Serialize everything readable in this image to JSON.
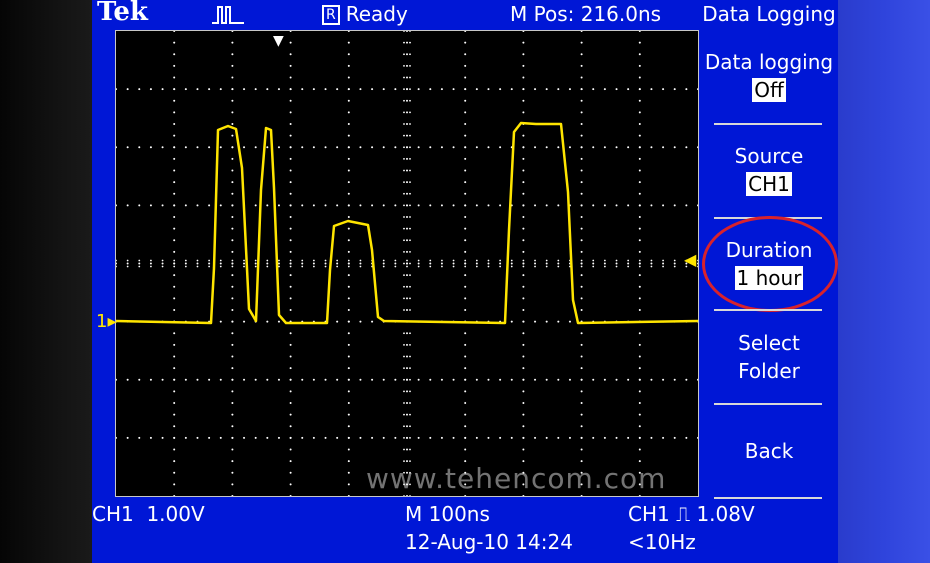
{
  "header": {
    "brand": "Tek",
    "trigger_icon": "pulse-trigger-icon",
    "status_indicator": "R",
    "status": "Ready",
    "horizontal_position": "M Pos: 216.0ns"
  },
  "menu": {
    "title": "Data Logging",
    "items": [
      {
        "label": "Data logging",
        "value": "Off"
      },
      {
        "label": "Source",
        "value": "CH1"
      },
      {
        "label": "Duration",
        "value": "1 hour",
        "highlighted": true
      },
      {
        "label": "Select\nFolder",
        "value": ""
      },
      {
        "label": "Back",
        "value": ""
      }
    ]
  },
  "footer": {
    "ch1_scale": "CH1  1.00V",
    "timebase": "M 100ns",
    "datetime": "12-Aug-10 14:24",
    "trigger_info": "CH1 ⎍ 1.08V",
    "trigger_freq": "<10Hz"
  },
  "screen": {
    "channel_marker": "1",
    "trace_color": "#ffe500",
    "grid_color": "#ffffff",
    "background": "#000000"
  },
  "watermark": "www.tehencom.com",
  "colors": {
    "panel": "#0017d6",
    "highlight": "#d8222c"
  }
}
